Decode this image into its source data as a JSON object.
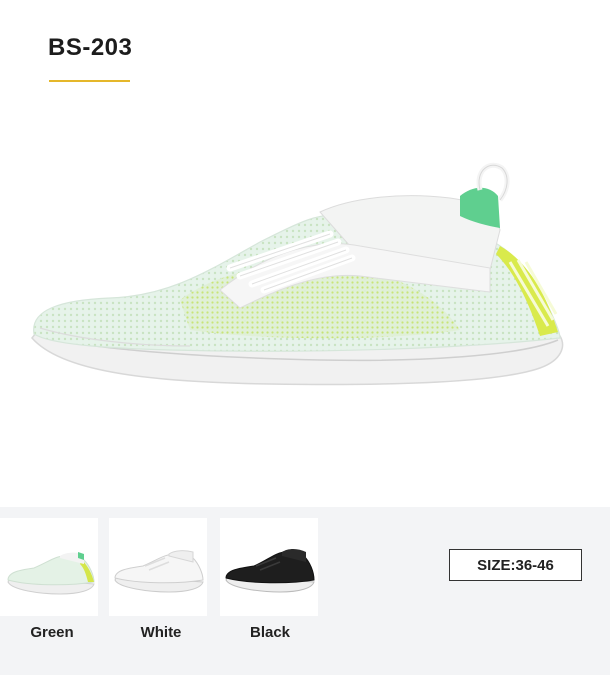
{
  "product": {
    "code": "BS-203",
    "accent": "#e5b72a"
  },
  "variants": [
    {
      "label": "Green",
      "upper": "#e8f4ec",
      "accent": "#c9e54a",
      "sole": "#f2f2f2"
    },
    {
      "label": "White",
      "upper": "#f4f4f4",
      "accent": "#e0e0e0",
      "sole": "#f0f0f0"
    },
    {
      "label": "Black",
      "upper": "#1e1e1e",
      "accent": "#333333",
      "sole": "#f0f0f0"
    }
  ],
  "size": {
    "text": "SIZE:36-46"
  }
}
